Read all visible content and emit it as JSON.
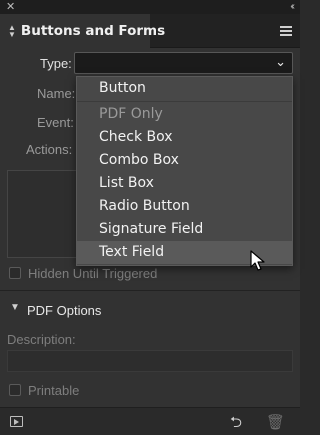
{
  "window": {
    "close_glyph": "✕",
    "collapse_glyph": "‹‹"
  },
  "tab": {
    "title": "Buttons and Forms"
  },
  "form": {
    "type_label": "Type:",
    "type_value": "",
    "name_label": "Name:",
    "event_label": "Event:",
    "actions_label": "Actions:",
    "hidden_until_triggered": "Hidden Until Triggered",
    "pdf_options": "PDF Options",
    "description_label": "Description:",
    "description_value": "",
    "printable": "Printable"
  },
  "dropdown": {
    "items": [
      {
        "label": "Button",
        "enabled": true
      },
      {
        "label": "PDF Only",
        "enabled": false
      },
      {
        "label": "Check Box",
        "enabled": true
      },
      {
        "label": "Combo Box",
        "enabled": true
      },
      {
        "label": "List Box",
        "enabled": true
      },
      {
        "label": "Radio Button",
        "enabled": true
      },
      {
        "label": "Signature Field",
        "enabled": true
      },
      {
        "label": "Text Field",
        "enabled": true,
        "highlighted": true
      }
    ]
  },
  "icons": {
    "panel_menu": "hamburger-icon",
    "preview": "preview-icon",
    "convert": "convert-to-object-icon",
    "trash": "trash-icon"
  },
  "colors": {
    "panel_bg": "#323232",
    "menu_bg": "#484848",
    "menu_highlight": "#5a5a5a"
  }
}
